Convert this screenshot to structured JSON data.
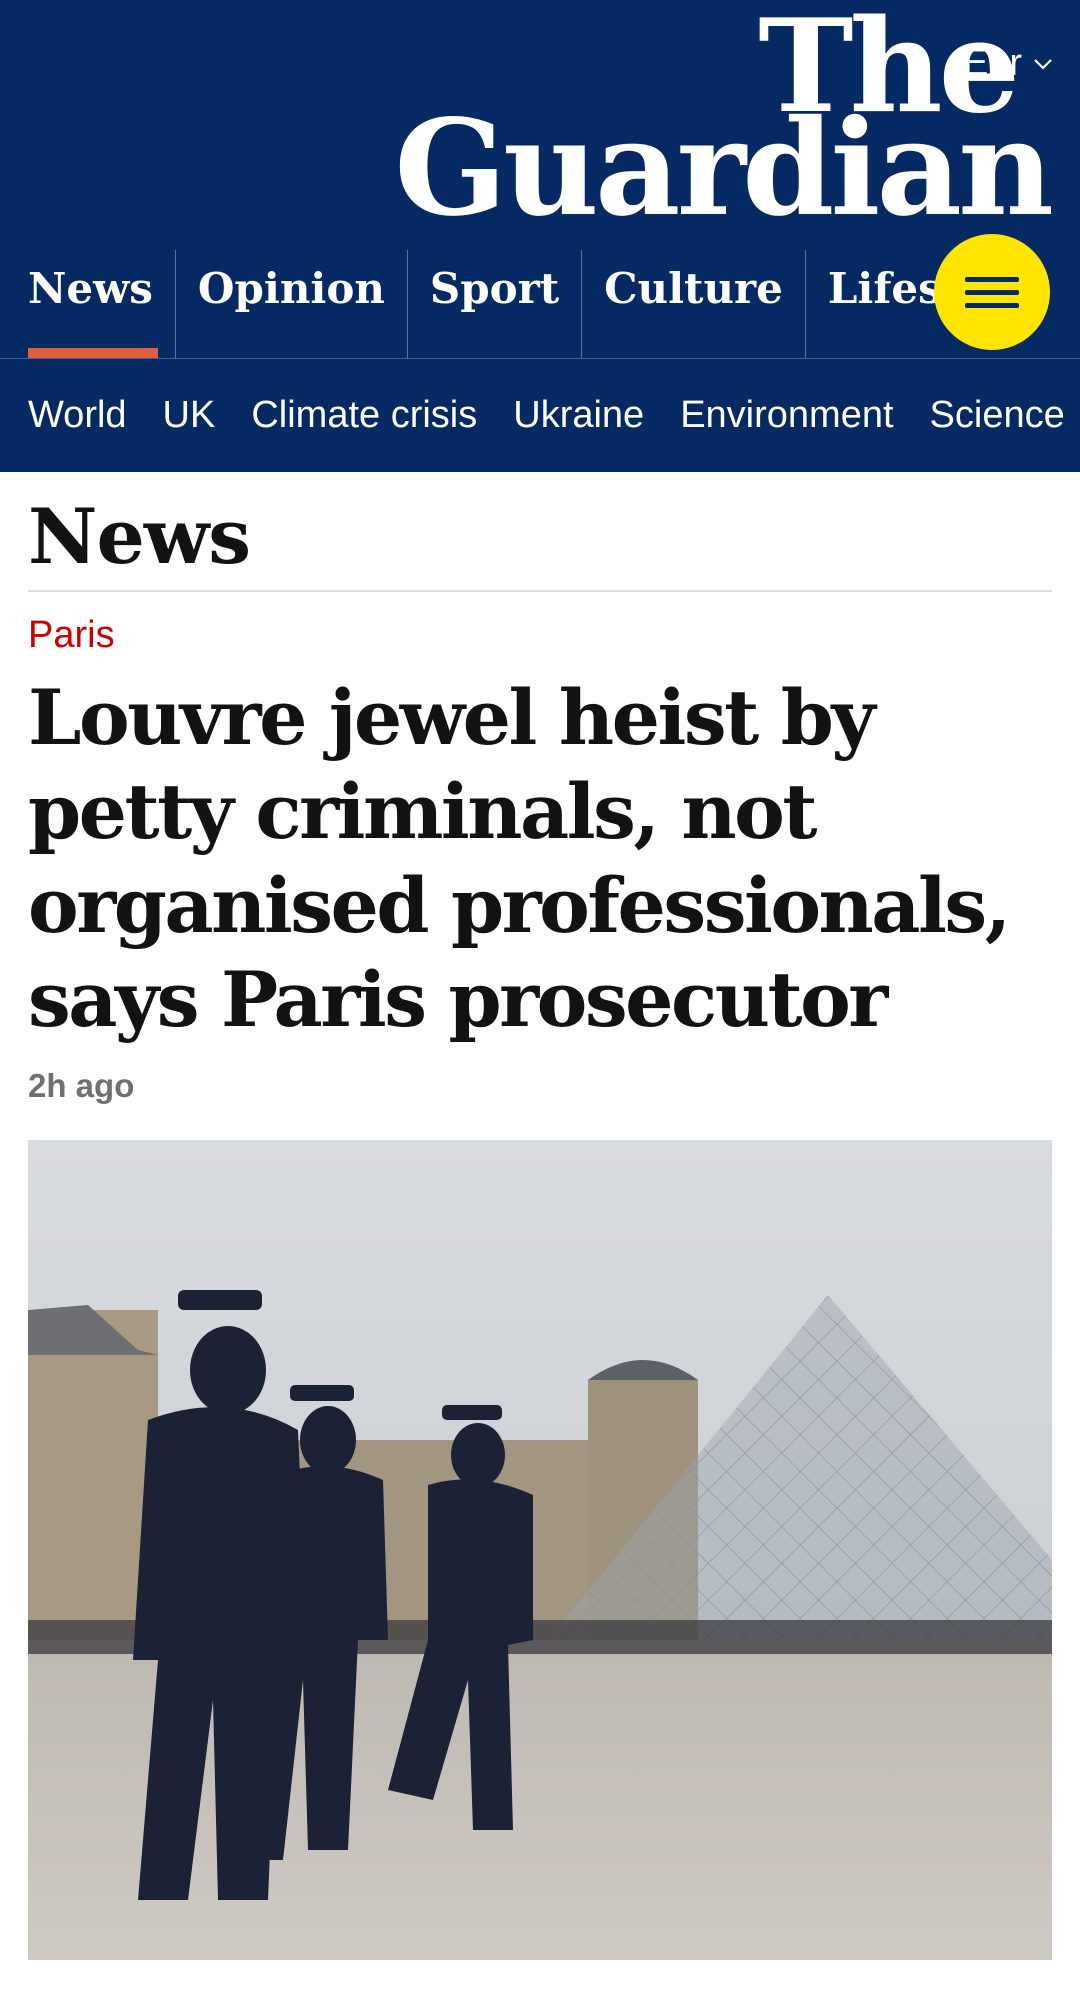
{
  "header": {
    "edition": "Eur",
    "logo_line1": "The",
    "logo_line2": "Guardian",
    "background": "#052962"
  },
  "pillars": [
    {
      "label": "News",
      "active": true
    },
    {
      "label": "Opinion"
    },
    {
      "label": "Sport"
    },
    {
      "label": "Culture"
    },
    {
      "label": "Lifestyle"
    }
  ],
  "subnav": [
    "World",
    "UK",
    "Climate crisis",
    "Ukraine",
    "Environment",
    "Science"
  ],
  "section": {
    "title": "News"
  },
  "article": {
    "kicker": "Paris",
    "headline": "Louvre jewel heist by petty criminals, not organised professionals, says Paris prosecutor",
    "age": "2h ago"
  },
  "colors": {
    "brand": "#052962",
    "menu_button": "#ffe500",
    "kicker": "#c70000",
    "active_pillar": "#e05e3d"
  }
}
